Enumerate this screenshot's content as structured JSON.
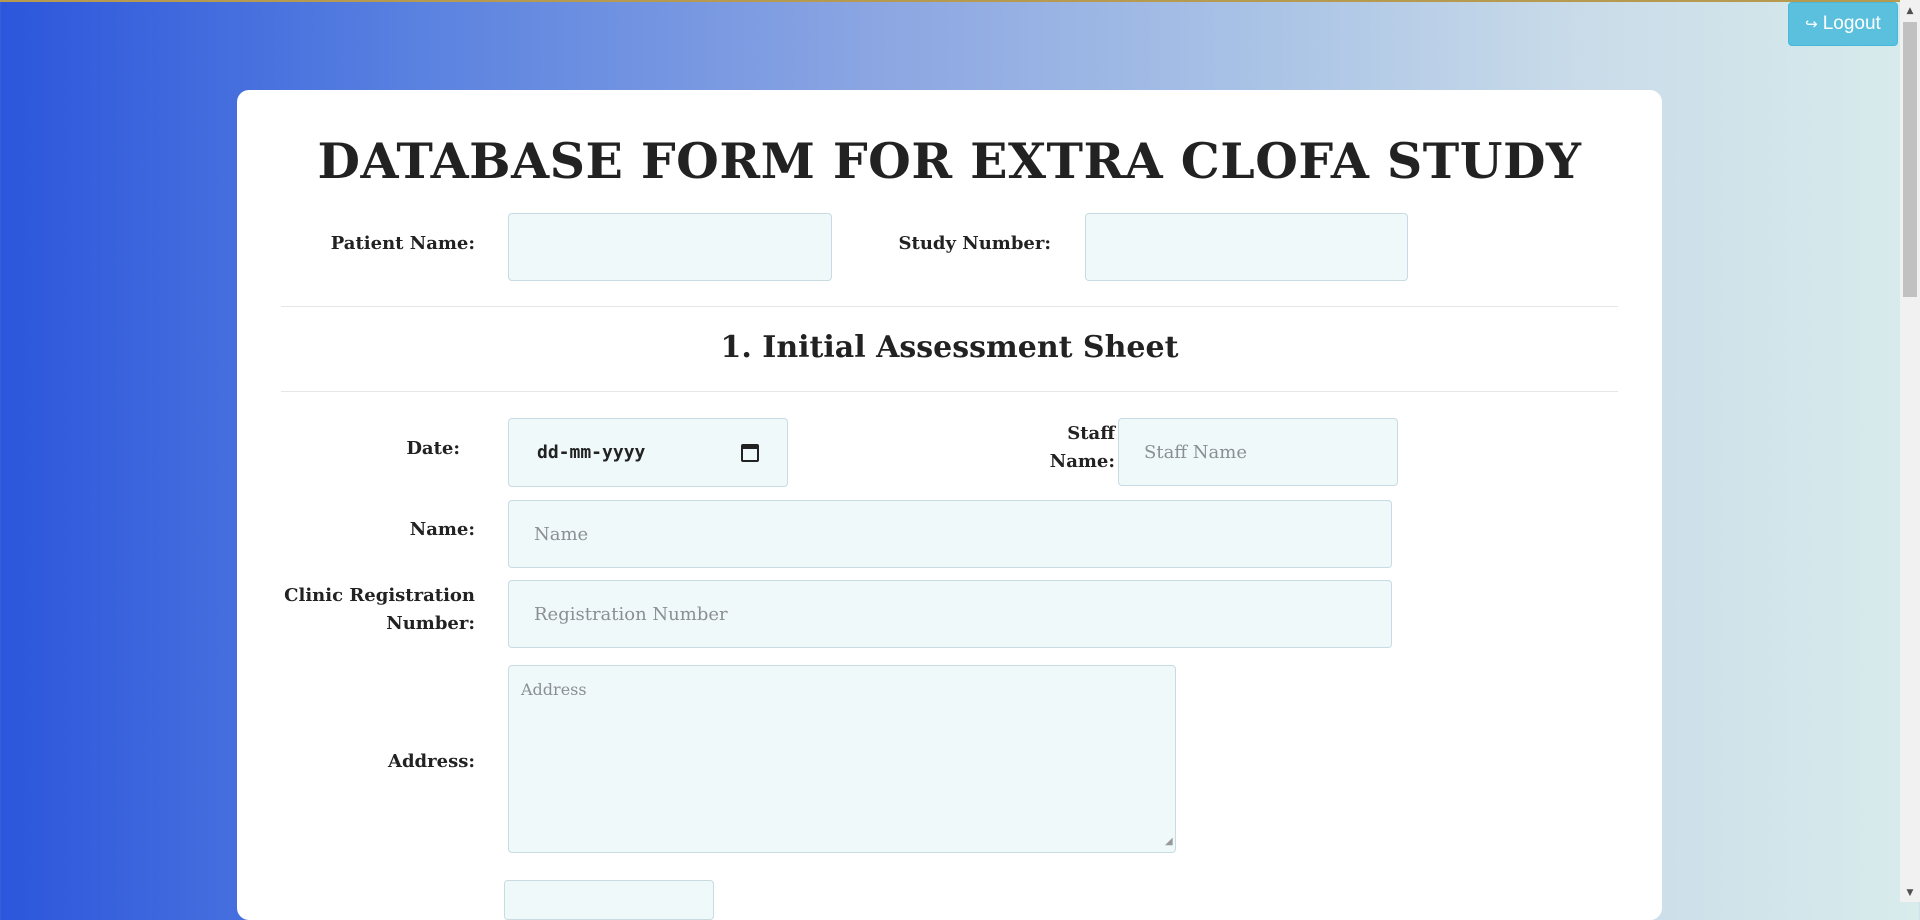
{
  "header": {
    "logout_label": "Logout",
    "logout_icon": "sign-out-icon"
  },
  "form": {
    "title": "DATABASE FORM FOR EXTRA CLOFA STUDY",
    "patient_name_label": "Patient Name:",
    "patient_name_value": "",
    "study_number_label": "Study Number:",
    "study_number_value": ""
  },
  "section1": {
    "title": "1. Initial Assessment Sheet",
    "date_label": "Date:",
    "date_placeholder": "dd-mm-yyyy",
    "staff_label_line1": "Staff",
    "staff_label_line2": "Name:",
    "staff_placeholder": "Staff Name",
    "name_label": "Name:",
    "name_placeholder": "Name",
    "clinic_label_line1": "Clinic Registration",
    "clinic_label_line2": "Number:",
    "clinic_placeholder": "Registration Number",
    "address_label": "Address:",
    "address_placeholder": "Address"
  },
  "colors": {
    "button_info": "#5bc0de",
    "field_bg": "#f0f9fa",
    "text_dark": "#222222"
  }
}
